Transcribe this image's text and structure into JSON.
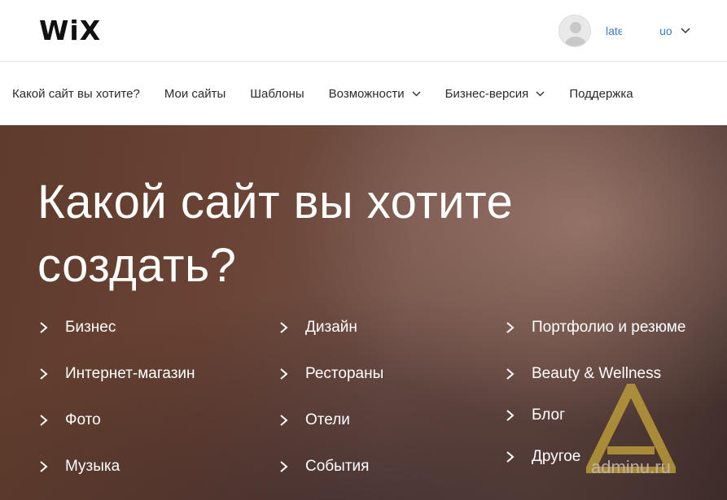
{
  "brand": {
    "logo_text": "WiX"
  },
  "account": {
    "name": "late████.uo",
    "avatar_icon": "user-avatar-icon",
    "menu_icon": "chevron-down-icon"
  },
  "nav": {
    "items": [
      {
        "label": "Какой сайт вы хотите?",
        "has_dropdown": false
      },
      {
        "label": "Мои сайты",
        "has_dropdown": false
      },
      {
        "label": "Шаблоны",
        "has_dropdown": false
      },
      {
        "label": "Возможности",
        "has_dropdown": true
      },
      {
        "label": "Бизнес-версия",
        "has_dropdown": true
      },
      {
        "label": "Поддержка",
        "has_dropdown": false
      }
    ]
  },
  "hero": {
    "title_line1": "Какой сайт вы хотите",
    "title_line2": "создать?",
    "columns": [
      [
        "Бизнес",
        "Интернет-магазин",
        "Фото",
        "Музыка"
      ],
      [
        "Дизайн",
        "Рестораны",
        "Отели",
        "События"
      ],
      [
        "Портфолио и резюме",
        "Beauty & Wellness",
        "Блог",
        "Другое"
      ]
    ],
    "item_icon": "chevron-right-icon"
  },
  "watermark": {
    "text": "adminu.ru",
    "icon": "triangle-a-logo"
  },
  "colors": {
    "link": "#3b7bd9",
    "hero_text": "#ffffff",
    "nav_text": "#2b2b2b"
  }
}
